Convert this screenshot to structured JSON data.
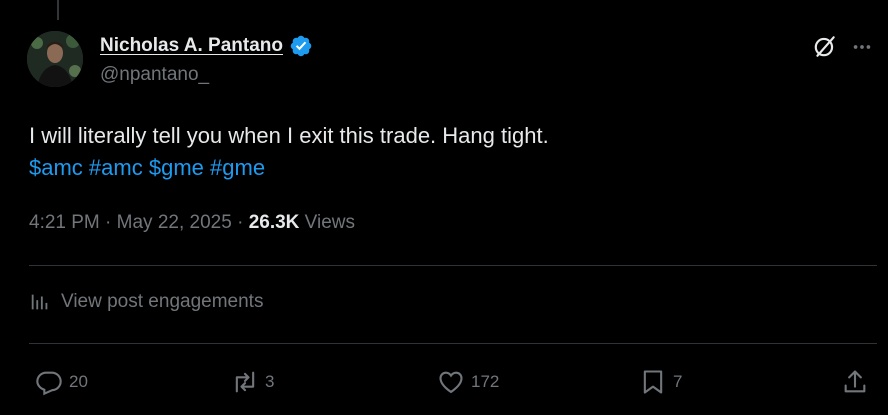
{
  "author": {
    "name": "Nicholas A. Pantano",
    "handle": "@npantano_",
    "verified": true
  },
  "tweet": {
    "text": "I will literally tell you when I exit this trade. Hang tight.",
    "tags": [
      "$amc",
      "#amc",
      "$gme",
      "#gme"
    ]
  },
  "meta": {
    "time": "4:21 PM",
    "separator": "·",
    "date": "May 22, 2025",
    "views_count": "26.3K",
    "views_label": "Views"
  },
  "engagements": {
    "label": "View post engagements"
  },
  "actions": {
    "replies": "20",
    "reposts": "3",
    "likes": "172",
    "bookmarks": "7"
  },
  "colors": {
    "background": "#000000",
    "accent": "#1d9bf0",
    "muted": "#71767b",
    "text": "#e7e9ea",
    "divider": "#2f3336"
  },
  "icons": [
    "verified-badge-icon",
    "grok-icon",
    "more-icon",
    "analytics-icon",
    "reply-icon",
    "repost-icon",
    "like-icon",
    "bookmark-icon",
    "share-icon"
  ]
}
